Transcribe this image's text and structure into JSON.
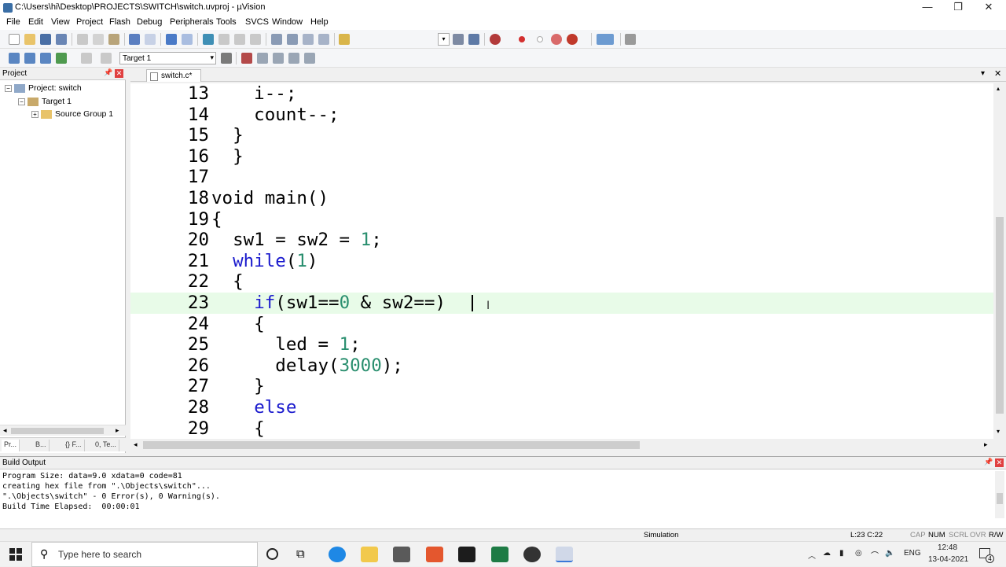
{
  "window": {
    "title": "C:\\Users\\hi\\Desktop\\PROJECTS\\SWITCH\\switch.uvproj - µVision",
    "minimize": "—",
    "maximize": "❐",
    "close": "✕"
  },
  "menu": [
    "File",
    "Edit",
    "View",
    "Project",
    "Flash",
    "Debug",
    "Peripherals",
    "Tools",
    "SVCS",
    "Window",
    "Help"
  ],
  "toolbar2": {
    "target_select": "Target 1"
  },
  "project_panel": {
    "title": "Project",
    "pin_icon": "pin-icon",
    "close_icon": "close-icon",
    "tree": {
      "project": "Project: switch",
      "target": "Target 1",
      "group": "Source Group 1"
    },
    "tabs": [
      "Pr...",
      "B...",
      "{} F...",
      "0, Te..."
    ]
  },
  "editor": {
    "file_tab": "switch.c*",
    "lines": [
      {
        "n": "13",
        "segments": [
          {
            "t": "    i--;",
            "c": "plain"
          }
        ]
      },
      {
        "n": "14",
        "segments": [
          {
            "t": "    count--;",
            "c": "plain"
          }
        ]
      },
      {
        "n": "15",
        "segments": [
          {
            "t": "  }",
            "c": "plain"
          }
        ]
      },
      {
        "n": "16",
        "segments": [
          {
            "t": "  }",
            "c": "plain"
          }
        ]
      },
      {
        "n": "17",
        "segments": []
      },
      {
        "n": "18",
        "segments": [
          {
            "t": "void main()",
            "c": "plain"
          }
        ]
      },
      {
        "n": "19",
        "segments": [
          {
            "t": "{",
            "c": "plain"
          }
        ]
      },
      {
        "n": "20",
        "segments": [
          {
            "t": "  sw1 = sw2 = ",
            "c": "plain"
          },
          {
            "t": "1",
            "c": "num"
          },
          {
            "t": ";",
            "c": "plain"
          }
        ]
      },
      {
        "n": "21",
        "segments": [
          {
            "t": "  ",
            "c": "plain"
          },
          {
            "t": "while",
            "c": "kw"
          },
          {
            "t": "(",
            "c": "plain"
          },
          {
            "t": "1",
            "c": "num"
          },
          {
            "t": ")",
            "c": "plain"
          }
        ]
      },
      {
        "n": "22",
        "segments": [
          {
            "t": "  {",
            "c": "plain"
          }
        ]
      },
      {
        "n": "23",
        "segments": [
          {
            "t": "    ",
            "c": "plain"
          },
          {
            "t": "if",
            "c": "kw"
          },
          {
            "t": "(sw1==",
            "c": "plain"
          },
          {
            "t": "0",
            "c": "num"
          },
          {
            "t": " & sw2==)",
            "c": "plain"
          }
        ],
        "current": true
      },
      {
        "n": "24",
        "segments": [
          {
            "t": "    {",
            "c": "plain"
          }
        ]
      },
      {
        "n": "25",
        "segments": [
          {
            "t": "      led = ",
            "c": "plain"
          },
          {
            "t": "1",
            "c": "num"
          },
          {
            "t": ";",
            "c": "plain"
          }
        ]
      },
      {
        "n": "26",
        "segments": [
          {
            "t": "      delay(",
            "c": "plain"
          },
          {
            "t": "3000",
            "c": "num"
          },
          {
            "t": ");",
            "c": "plain"
          }
        ]
      },
      {
        "n": "27",
        "segments": [
          {
            "t": "    }",
            "c": "plain"
          }
        ]
      },
      {
        "n": "28",
        "segments": [
          {
            "t": "    ",
            "c": "plain"
          },
          {
            "t": "else",
            "c": "kw"
          }
        ]
      },
      {
        "n": "29",
        "segments": [
          {
            "t": "    {",
            "c": "plain"
          }
        ]
      }
    ]
  },
  "build_output": {
    "title": "Build Output",
    "lines": [
      "Program Size: data=9.0 xdata=0 code=81",
      "creating hex file from \".\\Objects\\switch\"...",
      "\".\\Objects\\switch\" - 0 Error(s), 0 Warning(s).",
      "Build Time Elapsed:  00:00:01"
    ]
  },
  "status": {
    "mode": "Simulation",
    "position": "L:23 C:22",
    "caps": "CAP",
    "num": "NUM",
    "scrl": "SCRL",
    "ovr": "OVR",
    "rw": "R/W"
  },
  "taskbar": {
    "search_placeholder": "Type here to search",
    "lang": "ENG",
    "time": "12:48",
    "date": "13-04-2021",
    "notifications": "4"
  },
  "colors": {
    "keyword": "#1a1acd",
    "number": "#2a8f6f",
    "current_line": "#e8fbe8"
  }
}
